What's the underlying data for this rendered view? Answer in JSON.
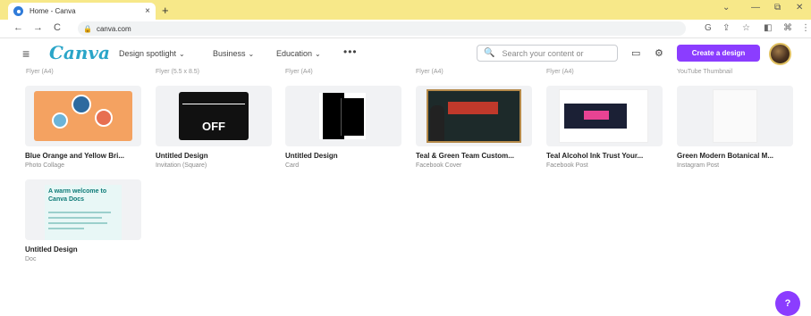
{
  "browser": {
    "tab_title": "Home - Canva",
    "new_tab": "+",
    "close_tab": "×",
    "url": "canva.com",
    "minimize": "—",
    "restore": "⧉",
    "close": "✕",
    "chevron": "⌄"
  },
  "header": {
    "logo": "Canva",
    "nav": [
      {
        "label": "Design spotlight"
      },
      {
        "label": "Business"
      },
      {
        "label": "Education"
      }
    ],
    "more": "•••",
    "search_placeholder": "Search your content or",
    "create_label": "Create a design"
  },
  "previous_row_labels": [
    "Flyer (A4)",
    "Flyer (5.5 x 8.5)",
    "Flyer (A4)",
    "Flyer (A4)",
    "Flyer (A4)",
    "YouTube Thumbnail"
  ],
  "designs": [
    {
      "title": "Blue Orange and Yellow Bri...",
      "type": "Photo Collage"
    },
    {
      "title": "Untitled Design",
      "type": "Invitation (Square)",
      "thumb_text": "OFF"
    },
    {
      "title": "Untitled Design",
      "type": "Card"
    },
    {
      "title": "Teal & Green Team Custom...",
      "type": "Facebook Cover"
    },
    {
      "title": "Teal Alcohol Ink Trust Your...",
      "type": "Facebook Post"
    },
    {
      "title": "Green Modern Botanical M...",
      "type": "Instagram Post"
    },
    {
      "title": "Untitled Design",
      "type": "Doc",
      "thumb_text": "A warm welcome to Canva Docs"
    }
  ],
  "help_label": "?",
  "colors": {
    "accent": "#8b3dff",
    "tabbar": "#f7e889",
    "logo": "#2aa5c8"
  }
}
